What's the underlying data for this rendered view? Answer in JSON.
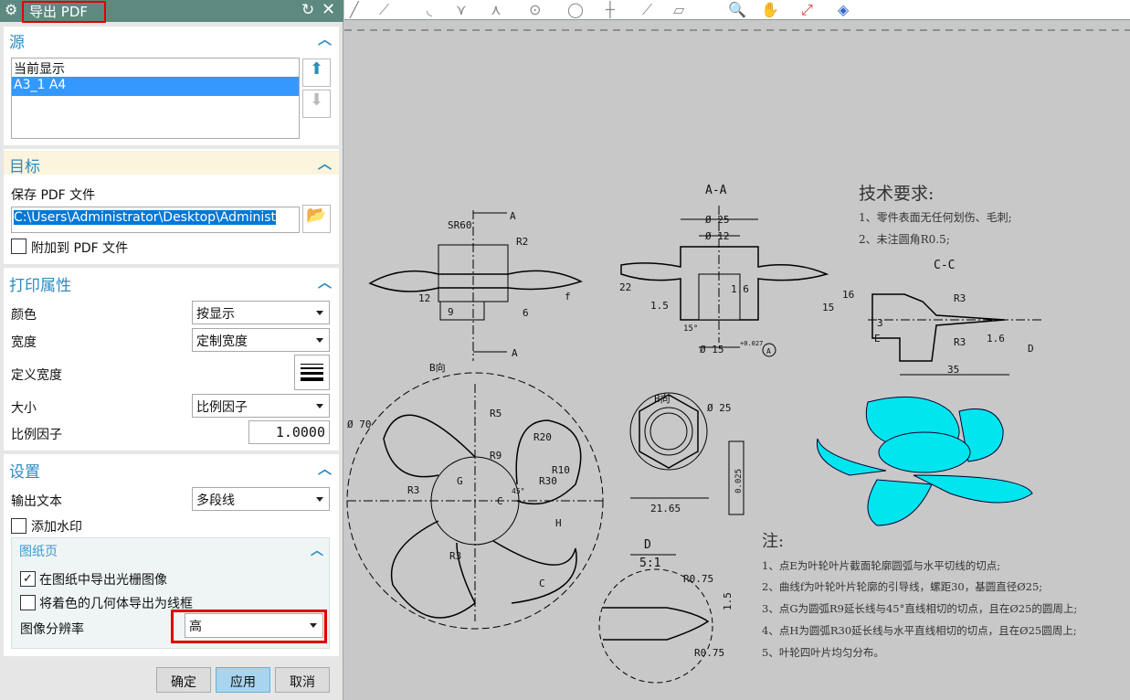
{
  "dialog": {
    "title": "导出 PDF",
    "source": {
      "header": "源",
      "items": [
        "当前显示",
        "A3_1  A4"
      ],
      "selected": 1
    },
    "target": {
      "header": "目标",
      "save_label": "保存 PDF 文件",
      "path": "C:\\Users\\Administrator\\Desktop\\Administ",
      "append_label": "附加到 PDF 文件",
      "append_checked": false
    },
    "print": {
      "header": "打印属性",
      "color_label": "颜色",
      "color_value": "按显示",
      "width_label": "宽度",
      "width_value": "定制宽度",
      "define_width_label": "定义宽度",
      "size_label": "大小",
      "size_value": "比例因子",
      "scale_label": "比例因子",
      "scale_value": "1.0000"
    },
    "settings": {
      "header": "设置",
      "output_text_label": "输出文本",
      "output_text_value": "多段线",
      "watermark_label": "添加水印",
      "watermark_checked": false,
      "sheet": {
        "header": "图纸页",
        "raster_label": "在图纸中导出光栅图像",
        "raster_checked": true,
        "wireframe_label": "将着色的几何体导出为线框",
        "wireframe_checked": false,
        "resolution_label": "图像分辨率",
        "resolution_value": "高"
      }
    },
    "buttons": {
      "ok": "确定",
      "apply": "应用",
      "cancel": "取消"
    }
  },
  "colors": {
    "titlebar": "#5d8980",
    "accent": "#2d8bc0",
    "selection": "#3399ff",
    "highlight_box": "#e00000",
    "shaded_part": "#00e5ee",
    "apply_button": "#a8d4ee"
  },
  "drawing": {
    "tech_title": "技术要求:",
    "tech": [
      "1、零件表面无任何划伤、毛刺;",
      "2、未注圆角R0.5;"
    ],
    "note_title": "注:",
    "notes": [
      "1、点E为叶轮叶片截面轮廓圆弧与水平切线的切点;",
      "2、曲线f为叶轮叶片轮廓的引导线，螺距30，基圆直径Ø25;",
      "3、点G为圆弧R9延长线与45°直线相切的切点，且在Ø25的圆周上;",
      "4、点H为圆弧R30延长线与水平直线相切的切点，且在Ø25圆周上;",
      "5、叶轮四叶片均匀分布。"
    ],
    "labels": {
      "aa": "A-A",
      "cc": "C-C",
      "b_view": "B向",
      "b_view2": "B向",
      "d": "D",
      "d_scale": "5:1",
      "sr60": "SR60",
      "a1": "A",
      "a2": "A",
      "r2": "R2",
      "f": "f",
      "d12": "12",
      "d9": "9",
      "d6": "6",
      "phi25": "Ø 25",
      "phi12": "Ø 12",
      "d22": "22",
      "d15": "1.5",
      "r16": "1.6",
      "d15b": "15",
      "d16": "16",
      "deg15": "15°",
      "phi15": "Ø 15",
      "tol": "+0.027",
      "datum": "A",
      "r3a": "R3",
      "r3b": "R3",
      "e": "E",
      "d3": "3",
      "d35": "35",
      "r16b": "1.6",
      "dd": "D",
      "phi70": "Ø 70",
      "r5": "R5",
      "r20": "R20",
      "r9": "R9",
      "r10": "R10",
      "r30": "R30",
      "g": "G",
      "c": "C",
      "r3c": "R3",
      "r3d": "R3",
      "h": "H",
      "c2": "C",
      "deg45": "45°",
      "phi25b": "Ø 25",
      "d2165": "21.65",
      "tol2": "0.025",
      "r075a": "R0.75",
      "r075b": "R0.75",
      "d15c": "1.5"
    }
  }
}
